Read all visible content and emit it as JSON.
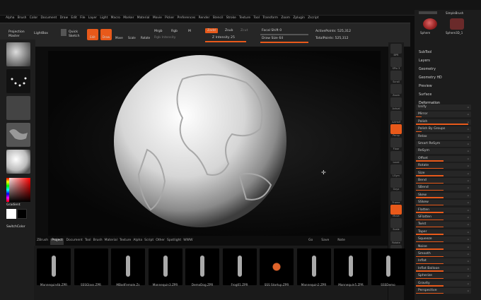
{
  "menu": [
    "Alpha",
    "Brush",
    "Color",
    "Document",
    "Draw",
    "Edit",
    "File",
    "Layer",
    "Light",
    "Macro",
    "Marker",
    "Material",
    "Movie",
    "Picker",
    "Preferences",
    "Render",
    "Stencil",
    "Stroke",
    "Texture",
    "Tool",
    "Transform",
    "Zoom",
    "Zplugin",
    "Zscript"
  ],
  "shelf": {
    "projection_master": "Projection Master",
    "lightbox": "LightBox",
    "quick_sketch": "Quick Sketch",
    "edit": "Edit",
    "draw": "Draw",
    "move": "Move",
    "scale": "Scale",
    "rotate": "Rotate",
    "mrgb": "Mrgb",
    "rgb": "Rgb",
    "m": "M",
    "rgb_intensity": "Rgb Intensity",
    "zadd": "Zadd",
    "zsub": "Zsub",
    "zcut": "Zcut",
    "z_intensity": "Z Intensity 25",
    "focal_shift": "Focal Shift 0",
    "draw_size": "Draw Size 64",
    "active_points": "ActivePoints: 525,312",
    "total_points": "TotalPoints: 525,312"
  },
  "right_top": {
    "sphere": "Sphere",
    "simplebrush": "SimpleBrush",
    "sphere3d": "Sphere3D_1"
  },
  "left_panel": {
    "gradient": "Gradient",
    "switch_color": "SwitchColor"
  },
  "right_dock": [
    "BPR",
    "SPix 3",
    "Scroll",
    "Zoom",
    "Actual",
    "AAHalf",
    "Persp",
    "Floor",
    "Local",
    "LSym",
    "Gxyz",
    "Frame",
    "Move",
    "Scale",
    "Rotate",
    "Transp",
    "Ghost",
    "Solo"
  ],
  "tray": {
    "subtool": "SubTool",
    "layers": "Layers",
    "geometry": "Geometry",
    "geometry_hd": "Geometry HD",
    "preview": "Preview",
    "surface": "Surface",
    "deformation": "Deformation"
  },
  "deformation": [
    "Unify",
    "Mirror",
    "Polish",
    "Polish By Groups",
    "Relax",
    "Smart ReSym",
    "ReSym",
    "Offset",
    "Rotate",
    "Size",
    "Bend",
    "SBend",
    "Skew",
    "SSkew",
    "Flatten",
    "SFlatten",
    "Twist",
    "Taper",
    "Squeeze",
    "Noise",
    "Smooth",
    "Inflat",
    "Inflat Balloon",
    "Spherize",
    "Gravity",
    "Perspective"
  ],
  "bottom_tabs": [
    "ZBrush",
    "Project",
    "Document",
    "Tool",
    "Brush",
    "Material",
    "Texture",
    "Alpha",
    "Script",
    "Other",
    "Spotlight",
    "WWW"
  ],
  "bottom_buttons": [
    "Go",
    "Save",
    "Note"
  ],
  "projects": [
    "Mannequin4b.ZPR",
    "SSSGlass.ZPR",
    "MBodFemale.Zs",
    "Mannequin3.ZPR",
    "DemoDog.ZPR",
    "Frog01.ZPR",
    "SSS Startup.ZPR",
    "Mannequin2.ZPR",
    "Mannequin5.ZPR",
    "SSSDemo"
  ]
}
